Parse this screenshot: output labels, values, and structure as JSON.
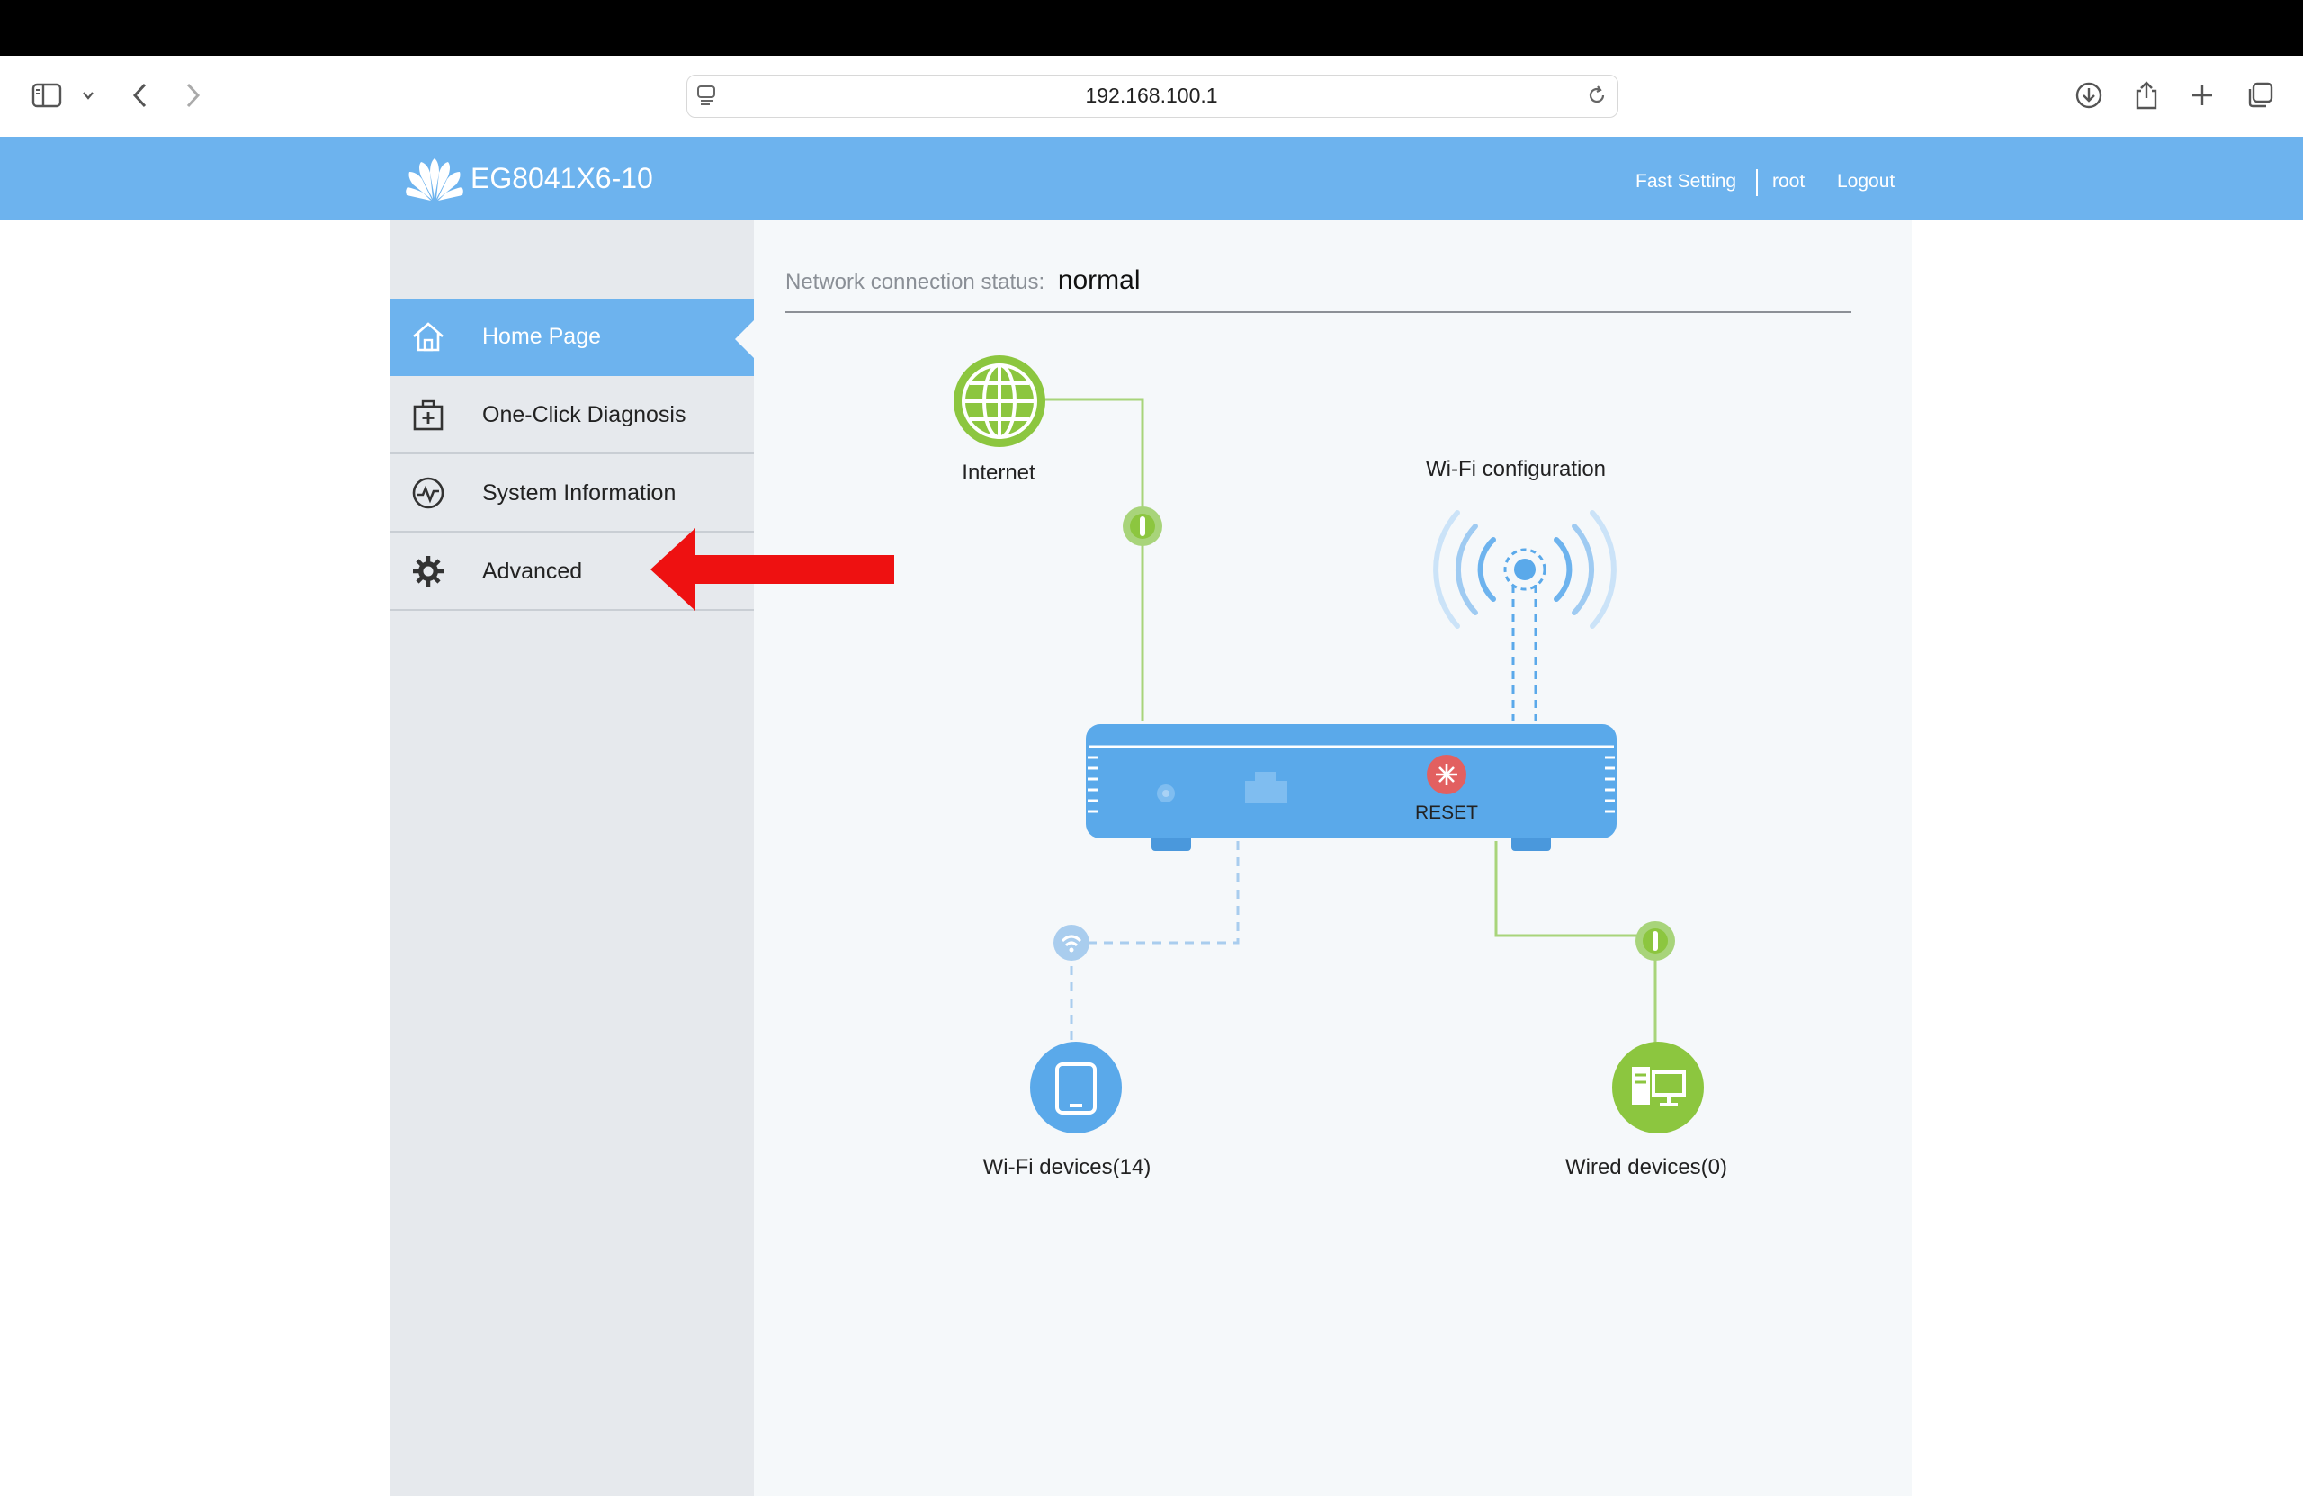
{
  "browser": {
    "url": "192.168.100.1"
  },
  "header": {
    "model": "EG8041X6-10",
    "links": {
      "fast_setting": "Fast Setting",
      "user": "root",
      "logout": "Logout"
    }
  },
  "sidebar": {
    "items": [
      {
        "label": "Home Page",
        "icon": "home-icon",
        "active": true
      },
      {
        "label": "One-Click Diagnosis",
        "icon": "medical-kit-icon",
        "active": false
      },
      {
        "label": "System Information",
        "icon": "activity-icon",
        "active": false
      },
      {
        "label": "Advanced",
        "icon": "gear-icon",
        "active": false
      }
    ]
  },
  "main": {
    "status_label": "Network connection status:",
    "status_value": "normal",
    "diagram": {
      "internet_label": "Internet",
      "wifi_config_label": "Wi-Fi configuration",
      "reset_label": "RESET",
      "wifi_devices_label": "Wi-Fi devices(14)",
      "wired_devices_label": "Wired devices(0)"
    }
  },
  "colors": {
    "header_blue": "#6db3ee",
    "green": "#8cc63f",
    "router_blue": "#5aa9ea",
    "annotation_red": "#ee1111"
  }
}
